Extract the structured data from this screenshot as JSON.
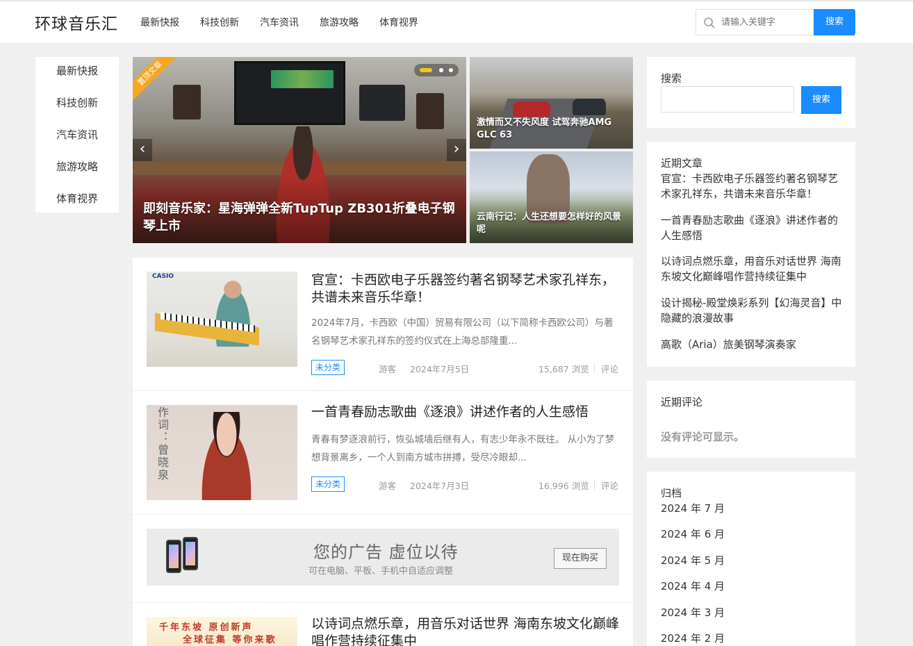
{
  "site": {
    "logo": "环球音乐汇",
    "nav": [
      "最新快报",
      "科技创新",
      "汽车资讯",
      "旅游攻略",
      "体育视界"
    ],
    "search_placeholder": "请输入关键字",
    "search_button": "搜索"
  },
  "leftnav": [
    "最新快报",
    "科技创新",
    "汽车资讯",
    "旅游攻略",
    "体育视界"
  ],
  "slider": {
    "ribbon": "置顶文章",
    "caption": "即刻音乐家：星海弹弹全新TupTup ZB301折叠电子钢琴上市",
    "prev": "‹",
    "next": "›",
    "dots_total": 3,
    "dots_active": 1
  },
  "tiles": [
    {
      "caption": "激情而又不失风度 试驾奔驰AMG GLC 63"
    },
    {
      "caption": "云南行记：人生还想要怎样好的风景呢"
    }
  ],
  "articles": [
    {
      "title": "官宣：卡西欧电子乐器签约著名钢琴艺术家孔祥东，共谱未来音乐华章！",
      "excerpt": "2024年7月，卡西欧（中国）贸易有限公司（以下简称卡西欧公司）与著名钢琴艺术家孔祥东的签约仪式在上海总部隆重...",
      "tag": "未分类",
      "author": "游客",
      "date": "2024年7月5日",
      "views": "15,687 浏览",
      "comment": "评论",
      "thumb_logo": "CASIO"
    },
    {
      "title": "一首青春励志歌曲《逐浪》讲述作者的人生感悟",
      "excerpt": "青春有梦逐浪前行，恢弘城墙后继有人，有志少年永不既往。 从小为了梦想背景离乡，一个人到南方城市拼搏，受尽冷眼却...",
      "tag": "未分类",
      "author": "游客",
      "date": "2024年7月3日",
      "views": "16,996 浏览",
      "comment": "评论",
      "thumb_text": "作词：曾晓泉"
    },
    {
      "title": "以诗词点燃乐章，用音乐对话世界 海南东坡文化巅峰唱作营持续征集中",
      "thumb_line1": "千年东坡 原创新声",
      "thumb_line2": "全球征集 等你来歌"
    }
  ],
  "ad": {
    "title": "您的广告 虚位以待",
    "subtitle": "可在电脑、平板、手机中自适应调整",
    "button": "现在购买"
  },
  "sidebar": {
    "search": {
      "title": "搜索",
      "button": "搜索"
    },
    "recent_posts": {
      "title": "近期文章",
      "items": [
        "官宣：卡西欧电子乐器签约著名钢琴艺术家孔祥东，共谱未来音乐华章！",
        "一首青春励志歌曲《逐浪》讲述作者的人生感悟",
        "以诗词点燃乐章，用音乐对话世界 海南东坡文化巅峰唱作营持续征集中",
        "设计揭秘-殿堂焕彩系列【幻海灵音】中隐藏的浪漫故事",
        "高歌（Aria）旅美钢琴演奏家"
      ]
    },
    "recent_comments": {
      "title": "近期评论",
      "empty": "没有评论可显示。"
    },
    "archives": {
      "title": "归档",
      "items": [
        "2024 年 7 月",
        "2024 年 6 月",
        "2024 年 5 月",
        "2024 年 4 月",
        "2024 年 3 月",
        "2024 年 2 月"
      ]
    }
  },
  "colors": {
    "accent": "#1a8cff",
    "ribbon": "#f5a623",
    "active_dot": "#f5c518"
  }
}
